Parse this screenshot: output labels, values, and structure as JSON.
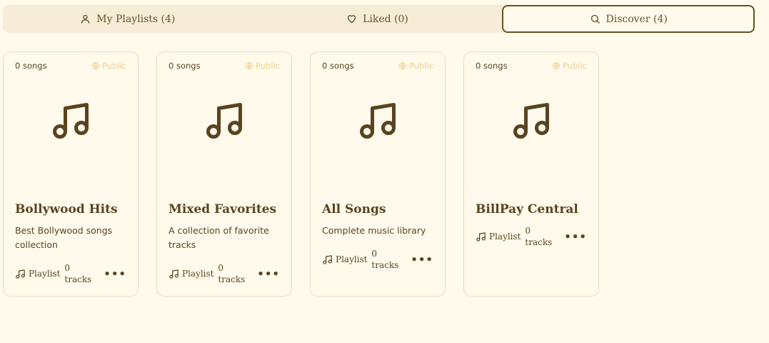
{
  "tabs": [
    {
      "label": "My Playlists (4)",
      "icon": "user-icon"
    },
    {
      "label": "Liked (0)",
      "icon": "heart-icon"
    },
    {
      "label": "Discover (4)",
      "icon": "search-icon",
      "active": true
    }
  ],
  "playlists": [
    {
      "songs": "0 songs",
      "visibility": "Public",
      "title": "Bollywood Hits",
      "description": "Best Bollywood songs collection",
      "kind": "Playlist",
      "count_num": "0",
      "count_unit": "tracks",
      "more": "•••"
    },
    {
      "songs": "0 songs",
      "visibility": "Public",
      "title": "Mixed Favorites",
      "description": "A collection of favorite tracks",
      "kind": "Playlist",
      "count_num": "0",
      "count_unit": "tracks",
      "more": "•••"
    },
    {
      "songs": "0 songs",
      "visibility": "Public",
      "title": "All Songs",
      "description": "Complete music library",
      "kind": "Playlist",
      "count_num": "0",
      "count_unit": "tracks",
      "more": "•••"
    },
    {
      "songs": "0 songs",
      "visibility": "Public",
      "title": "BillPay Central",
      "description": "",
      "kind": "Playlist",
      "count_num": "0",
      "count_unit": "tracks",
      "more": "•••"
    }
  ],
  "colors": {
    "background": "#fffaeb",
    "accent": "#5a4320",
    "public_badge": "#f0d08a"
  }
}
